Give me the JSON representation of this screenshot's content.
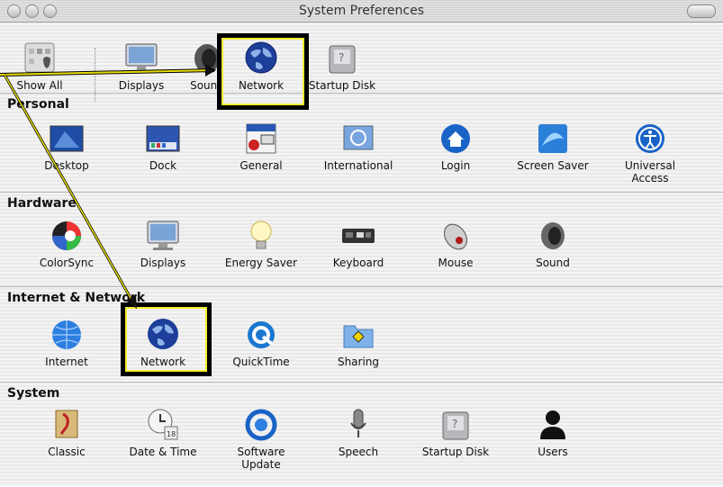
{
  "window": {
    "title": "System Preferences"
  },
  "toolbar": {
    "items": [
      {
        "label": "Show All",
        "icon": "show-all-icon"
      },
      {
        "label": "Displays",
        "icon": "displays-icon"
      },
      {
        "label": "Sound",
        "icon": "sound-icon"
      },
      {
        "label": "Network",
        "icon": "network-globe-icon"
      },
      {
        "label": "Startup Disk",
        "icon": "startup-disk-icon"
      }
    ]
  },
  "sections": [
    {
      "title": "Personal",
      "items": [
        {
          "label": "Desktop",
          "icon": "desktop-icon"
        },
        {
          "label": "Dock",
          "icon": "dock-icon"
        },
        {
          "label": "General",
          "icon": "general-icon"
        },
        {
          "label": "International",
          "icon": "international-flag-icon"
        },
        {
          "label": "Login",
          "icon": "login-house-icon"
        },
        {
          "label": "Screen Saver",
          "icon": "screen-saver-icon"
        },
        {
          "label": "Universal Access",
          "icon": "universal-access-icon"
        }
      ]
    },
    {
      "title": "Hardware",
      "items": [
        {
          "label": "ColorSync",
          "icon": "colorsync-icon"
        },
        {
          "label": "Displays",
          "icon": "displays-icon"
        },
        {
          "label": "Energy Saver",
          "icon": "lightbulb-icon"
        },
        {
          "label": "Keyboard",
          "icon": "keyboard-icon"
        },
        {
          "label": "Mouse",
          "icon": "mouse-icon"
        },
        {
          "label": "Sound",
          "icon": "speaker-icon"
        }
      ]
    },
    {
      "title": "Internet & Network",
      "items": [
        {
          "label": "Internet",
          "icon": "internet-globe-icon"
        },
        {
          "label": "Network",
          "icon": "network-globe-icon"
        },
        {
          "label": "QuickTime",
          "icon": "quicktime-icon"
        },
        {
          "label": "Sharing",
          "icon": "sharing-folder-icon"
        }
      ]
    },
    {
      "title": "System",
      "items": [
        {
          "label": "Classic",
          "icon": "classic-icon"
        },
        {
          "label": "Date & Time",
          "icon": "clock-calendar-icon"
        },
        {
          "label": "Software Update",
          "icon": "software-update-icon"
        },
        {
          "label": "Speech",
          "icon": "microphone-icon"
        },
        {
          "label": "Startup Disk",
          "icon": "startup-disk-icon"
        },
        {
          "label": "Users",
          "icon": "users-icon"
        }
      ]
    }
  ],
  "colors": {
    "highlight_border": "#000000",
    "highlight_inner": "#f2ee30",
    "annotation_line": "#d4c800"
  }
}
